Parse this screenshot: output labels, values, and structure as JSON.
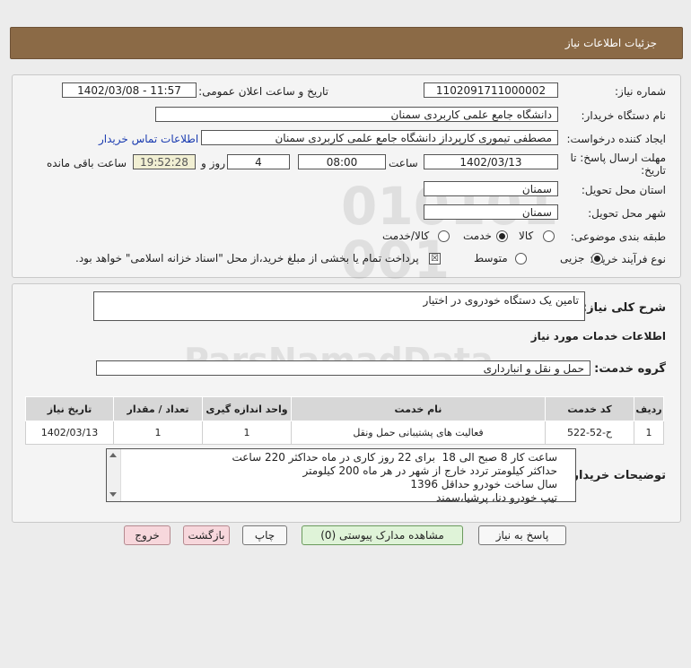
{
  "header": {
    "title": "جزئیات اطلاعات نیاز"
  },
  "form": {
    "need_number_label": "شماره نیاز:",
    "need_number": "1102091711000002",
    "announce_label": "تاریخ و ساعت اعلان عمومی:",
    "announce_value": "1402/03/08 - 11:57",
    "buyer_org_label": "نام دستگاه خریدار:",
    "buyer_org": "دانشگاه جامع علمی کاربردی سمنان",
    "requester_label": "ایجاد کننده درخواست:",
    "requester": "مصطفی تیموری کارپرداز دانشگاه جامع علمی کاربردی سمنان",
    "contact_link": "اطلاعات تماس خریدار",
    "deadline_label_1": "مهلت ارسال پاسخ: تا",
    "deadline_label_2": "تاریخ:",
    "deadline_date": "1402/03/13",
    "time_label": "ساعت",
    "deadline_time": "08:00",
    "days_value": "4",
    "days_label": "روز و",
    "timer": "19:52:28",
    "remaining_label": "ساعت باقی مانده",
    "province_label": "استان محل تحویل:",
    "province": "سمنان",
    "city_label": "شهر محل تحویل:",
    "city": "سمنان",
    "category_label": "طبقه بندی موضوعی:",
    "category_options": [
      "کالا",
      "خدمت",
      "کالا/خدمت"
    ],
    "category_selected": "خدمت",
    "purchase_label": "نوع فرآیند خرید :",
    "purchase_options": [
      "جزیی",
      "متوسط"
    ],
    "purchase_selected": "جزیی",
    "payment_note": "پرداخت تمام یا بخشی از مبلغ خرید،از محل \"اسناد خزانه اسلامی\" خواهد بود."
  },
  "summary": {
    "label": "شرح کلی نیاز:",
    "value": "تامین یک دستگاه خودروی در اختیار",
    "services_heading": "اطلاعات خدمات مورد نیاز",
    "group_label": "گروه خدمت:",
    "group_value": "حمل و نقل و انبارداری"
  },
  "table": {
    "headers": [
      "ردیف",
      "کد خدمت",
      "نام خدمت",
      "واحد اندازه گیری",
      "تعداد / مقدار",
      "تاریخ نیاز"
    ],
    "rows": [
      [
        "1",
        "ح-52-522",
        "فعالیت های پشتیبانی حمل ونقل",
        "1",
        "1",
        "1402/03/13"
      ]
    ]
  },
  "buyer_notes": {
    "label": "توضیحات خریدار:",
    "lines": [
      "ساعت کار 8 صبح الی 18  برای 22 روز کاری در ماه حداکثر 220 ساعت",
      "حداکثر کیلومتر تردد خارج از شهر در هر ماه 200 کیلومتر",
      "سال ساخت خودرو حداقل 1396",
      "تیپ خودرو دنا، پرشیا،سمند"
    ]
  },
  "buttons": {
    "reply": "پاسخ به نیاز",
    "attachments": "مشاهده مدارک پیوستی (0)",
    "print": "چاپ",
    "back": "بازگشت",
    "exit": "خروج"
  },
  "watermark": {
    "text": "ParsNamadData"
  }
}
